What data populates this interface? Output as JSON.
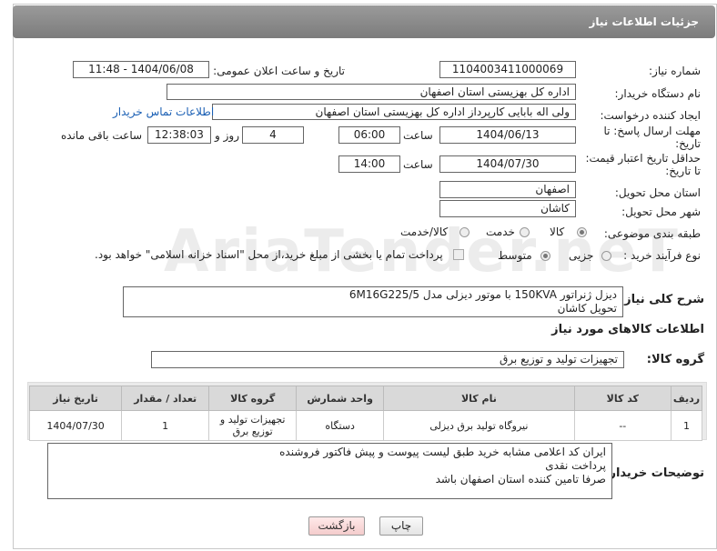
{
  "header": {
    "title": "جزئیات اطلاعات نیاز"
  },
  "form": {
    "need_number_label": "شماره نیاز:",
    "need_number": "1104003411000069",
    "announce_label": "تاریخ و ساعت اعلان عمومی:",
    "announce_value": "1404/06/08 - 11:48",
    "buyer_org_label": "نام دستگاه خریدار:",
    "buyer_org": "اداره کل بهزیستی استان اصفهان",
    "creator_label": "ایجاد کننده درخواست:",
    "creator": "ولی اله بابایی کارپرداز اداره کل بهزیستی استان اصفهان",
    "contact_link": "اطلاعات تماس خریدار",
    "deadline_label_1": "مهلت ارسال پاسخ: تا",
    "deadline_label_2": "تاریخ:",
    "deadline_date": "1404/06/13",
    "time_label": "ساعت",
    "deadline_time": "06:00",
    "days_value": "4",
    "days_label": "روز و",
    "remaining_time": "12:38:03",
    "remaining_label": "ساعت باقی مانده",
    "validity_label_1": "حداقل تاریخ اعتبار قیمت:",
    "validity_label_2": "تا تاریخ:",
    "validity_date": "1404/07/30",
    "validity_time": "14:00",
    "province_label": "استان محل تحویل:",
    "province": "اصفهان",
    "city_label": "شهر محل تحویل:",
    "city": "کاشان",
    "category_label": "طبقه بندی موضوعی:",
    "category_options": [
      "کالا",
      "خدمت",
      "کالا/خدمت"
    ],
    "purchase_type_label": "نوع فرآیند خرید :",
    "purchase_options": [
      "جزیی",
      "متوسط"
    ],
    "treasury_note": "پرداخت تمام یا بخشی از مبلغ خرید،از محل \"اسناد خزانه اسلامی\" خواهد بود.",
    "description_label": "شرح کلی نیاز:",
    "description_line1": "دیزل ژنراتور 150KVA با موتور دیزلی مدل 6M16G225/5",
    "description_line2": "تحویل کاشان",
    "goods_info_title": "اطلاعات کالاهای مورد نیاز",
    "goods_group_label": "گروه کالا:",
    "goods_group": "تجهیزات تولید و توزیع برق"
  },
  "table": {
    "headers": [
      "ردیف",
      "کد کالا",
      "نام کالا",
      "واحد شمارش",
      "گروه کالا",
      "تعداد / مقدار",
      "تاریخ نیاز"
    ],
    "rows": [
      [
        "1",
        "--",
        "نیروگاه تولید برق دیزلی",
        "دستگاه",
        "تجهیزات تولید و توزیع برق",
        "1",
        "1404/07/30"
      ]
    ]
  },
  "buyer_notes": {
    "label": "توضیحات خریدار:",
    "line1": "ایران کد اعلامی مشابه خرید طبق لیست پیوست و پیش فاکتور فروشنده",
    "line2": "پرداخت نقدی",
    "line3": "صرفا تامین کننده استان اصفهان باشد"
  },
  "buttons": {
    "print": "چاپ",
    "back": "بازگشت"
  },
  "watermark": "AriaTender.neT"
}
